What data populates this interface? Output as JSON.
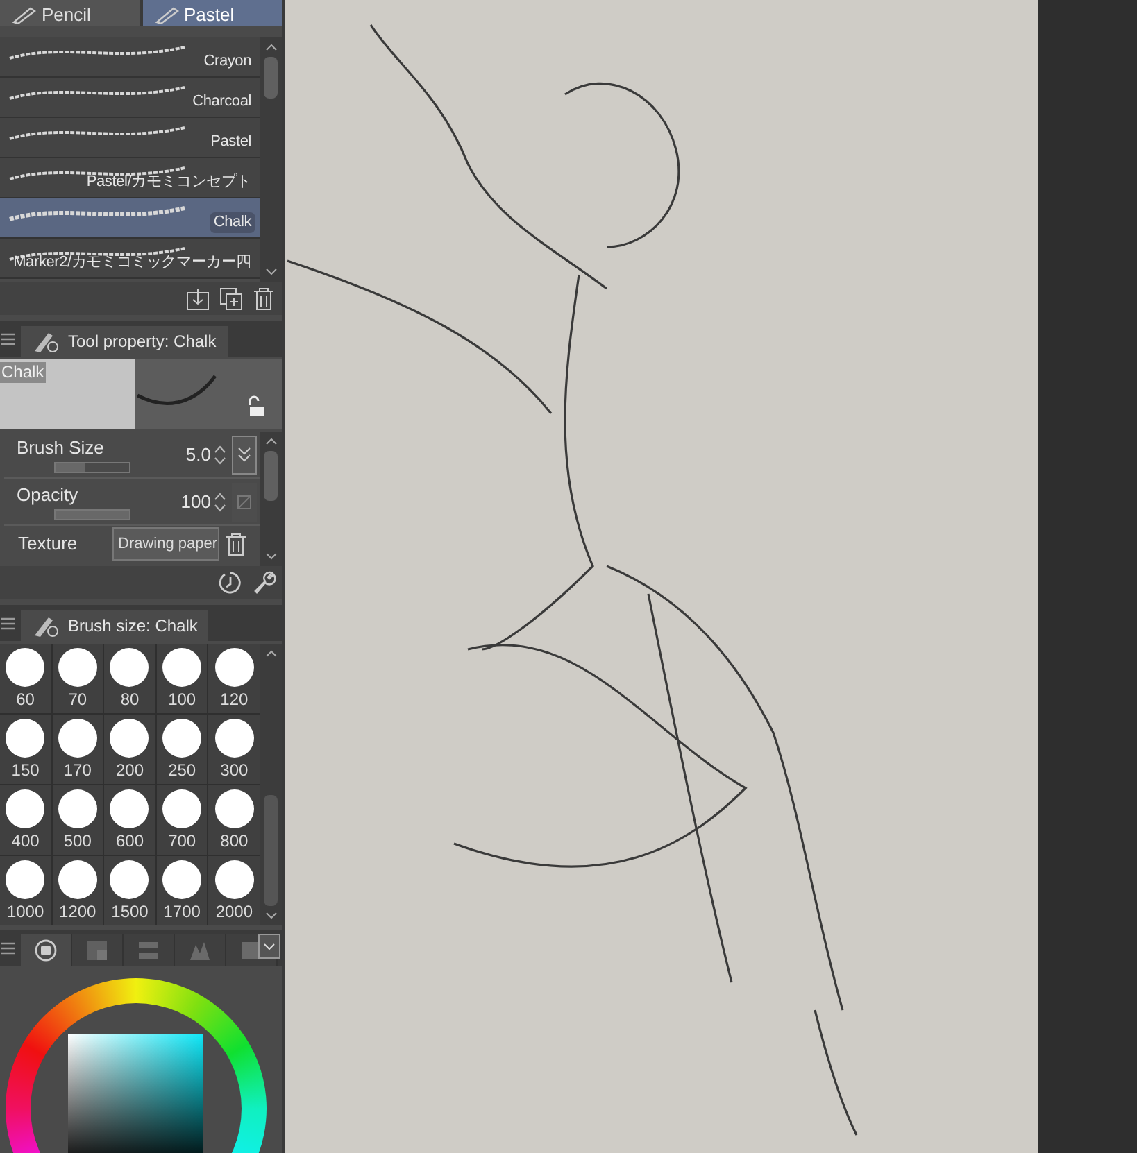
{
  "tool_tabs": [
    {
      "label": "Pencil",
      "selected": false
    },
    {
      "label": "Pastel",
      "selected": true
    }
  ],
  "brushes": [
    {
      "name": "Crayon",
      "selected": false
    },
    {
      "name": "Charcoal",
      "selected": false
    },
    {
      "name": "Pastel",
      "selected": false
    },
    {
      "name": "Pastel/カモミコンセプト",
      "selected": false
    },
    {
      "name": "Chalk",
      "selected": true
    },
    {
      "name": "Marker2/カモミコミックマーカー四",
      "selected": false
    }
  ],
  "tool_property": {
    "title": "Tool property: Chalk",
    "preview_label": "Chalk",
    "properties": [
      {
        "kind": "slider",
        "label": "Brush Size",
        "value": "5.0",
        "level": 0.4
      },
      {
        "kind": "slider",
        "label": "Opacity",
        "value": "100",
        "level": 1
      },
      {
        "kind": "select",
        "label": "Texture",
        "value": "Drawing paper"
      }
    ]
  },
  "brush_size": {
    "title": "Brush size: Chalk",
    "sizes": [
      "60",
      "70",
      "80",
      "100",
      "120",
      "150",
      "170",
      "200",
      "250",
      "300",
      "400",
      "500",
      "600",
      "700",
      "800",
      "1000",
      "1200",
      "1500",
      "1700",
      "2000"
    ]
  },
  "color_tabs": [
    {
      "selected": true
    },
    {
      "selected": false
    },
    {
      "selected": false
    },
    {
      "selected": false
    },
    {
      "selected": false
    }
  ]
}
